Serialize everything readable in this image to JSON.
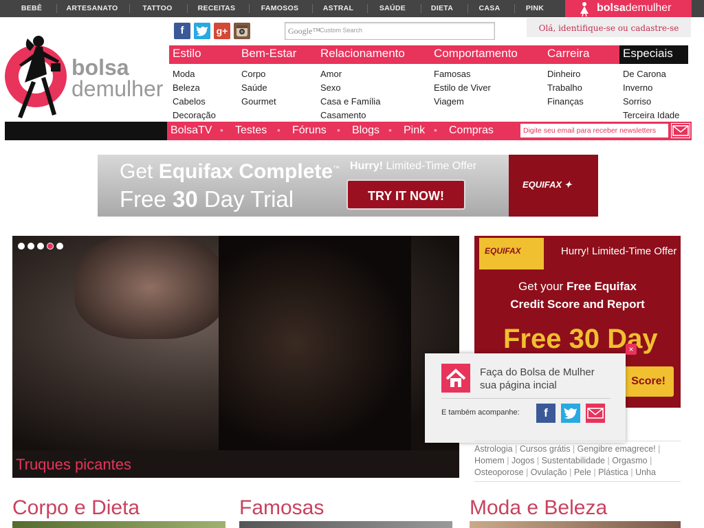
{
  "topbar": {
    "items": [
      "BEBÊ",
      "ARTESANATO",
      "TATTOO",
      "RECEITAS",
      "FAMOSOS",
      "ASTRAL",
      "SAÚDE",
      "DIETA",
      "CASA",
      "PINK"
    ],
    "brand_bold": "bolsa",
    "brand_rest": "demulher"
  },
  "header": {
    "search_brand": "Google™",
    "search_placeholder": "Custom Search",
    "login_text": "Olá, identifique-se ou cadastre-se",
    "logo_line1": "bolsa",
    "logo_line2": "demulher"
  },
  "menu": {
    "categories": [
      {
        "label": "Estilo",
        "items": [
          "Moda",
          "Beleza",
          "Cabelos",
          "Decoração"
        ]
      },
      {
        "label": "Bem-Estar",
        "items": [
          "Corpo",
          "Saúde",
          "Gourmet"
        ]
      },
      {
        "label": "Relacionamento",
        "items": [
          "Amor",
          "Sexo",
          "Casa e Família",
          "Casamento"
        ]
      },
      {
        "label": "Comportamento",
        "items": [
          "Famosas",
          "Estilo de Viver",
          "Viagem"
        ]
      },
      {
        "label": "Carreira",
        "items": [
          "Dinheiro",
          "Trabalho",
          "Finanças"
        ]
      },
      {
        "label": "Especiais",
        "items": [
          "De Carona",
          "Inverno",
          "Sorriso",
          "Terceira Idade"
        ]
      }
    ],
    "secondary": [
      "BolsaTV",
      "Testes",
      "Fóruns",
      "Blogs",
      "Pink",
      "Compras"
    ],
    "newsletter_placeholder": "Digite seu email para receber newsletters"
  },
  "banner_ad": {
    "line1_pre": "Get ",
    "line1_bold": "Equifax Complete",
    "tm": "™",
    "line2_pre": "Free ",
    "line2_bold": "30",
    "line2_post": " Day Trial",
    "hurry_bold": "Hurry!",
    "hurry_rest": " Limited-Time Offer",
    "cta": "TRY IT NOW!",
    "brand": "EQUIFAX"
  },
  "slider": {
    "caption": "Truques picantes",
    "dots": 5,
    "active_dot": 4
  },
  "side_ad": {
    "brand": "EQUIFAX",
    "hurry": "Hurry! Limited-Time Offer",
    "line1_pre": "Get your ",
    "line1_bold": "Free Equifax",
    "line2": "Credit Score and Report",
    "line3": "Free 30 Day Trial",
    "cta": "Score!"
  },
  "popup": {
    "message_line1": "Faça do Bolsa de Mulher",
    "message_line2": "sua página incial",
    "also_follow": "E também acompanhe:",
    "close": "×"
  },
  "tags": [
    "Astrologia",
    "Cursos grátis",
    "Gengibre emagrece!",
    "Homem",
    "Jogos",
    "Sustentabilidade",
    "Orgasmo",
    "Osteoporose",
    "Ovulação",
    "Pele",
    "Plástica",
    "Unha"
  ],
  "sections": [
    "Corpo e Dieta",
    "Famosas",
    "Moda e Beleza"
  ],
  "colors": {
    "brand_pink": "#e8335b",
    "dark_bar": "#444444",
    "ad_red": "#8e0e1b",
    "ad_gold": "#f0c030"
  }
}
